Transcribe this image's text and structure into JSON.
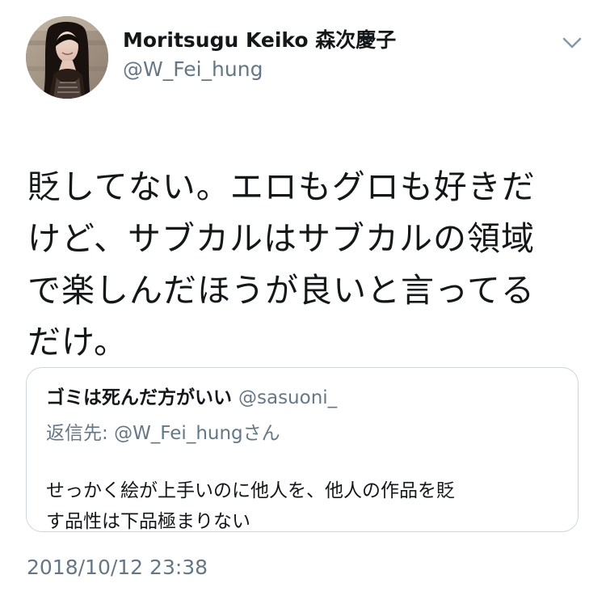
{
  "tweet": {
    "author": {
      "display_name": "Moritsugu Keiko 森次慶子",
      "handle": "@W_Fei_hung",
      "avatar_icon": "profile-photo"
    },
    "menu_icon": "chevron-down-icon",
    "text": "貶してない。エロもグロも好きだ\nけど、サブカルはサブカルの領域\nで楽しんだほうが良いと言ってる\nだけ。",
    "quoted_tweet": {
      "display_name": "ゴミは死んだ方がいい",
      "handle": "@sasuoni_",
      "reply_to_prefix": "返信先: ",
      "reply_to_handle": "@W_Fei_hung",
      "reply_to_suffix": "さん",
      "text": "せっかく絵が上手いのに他人を、他人の作品を貶\nす品性は下品極まりない"
    },
    "timestamp": "2018/10/12 23:38"
  }
}
